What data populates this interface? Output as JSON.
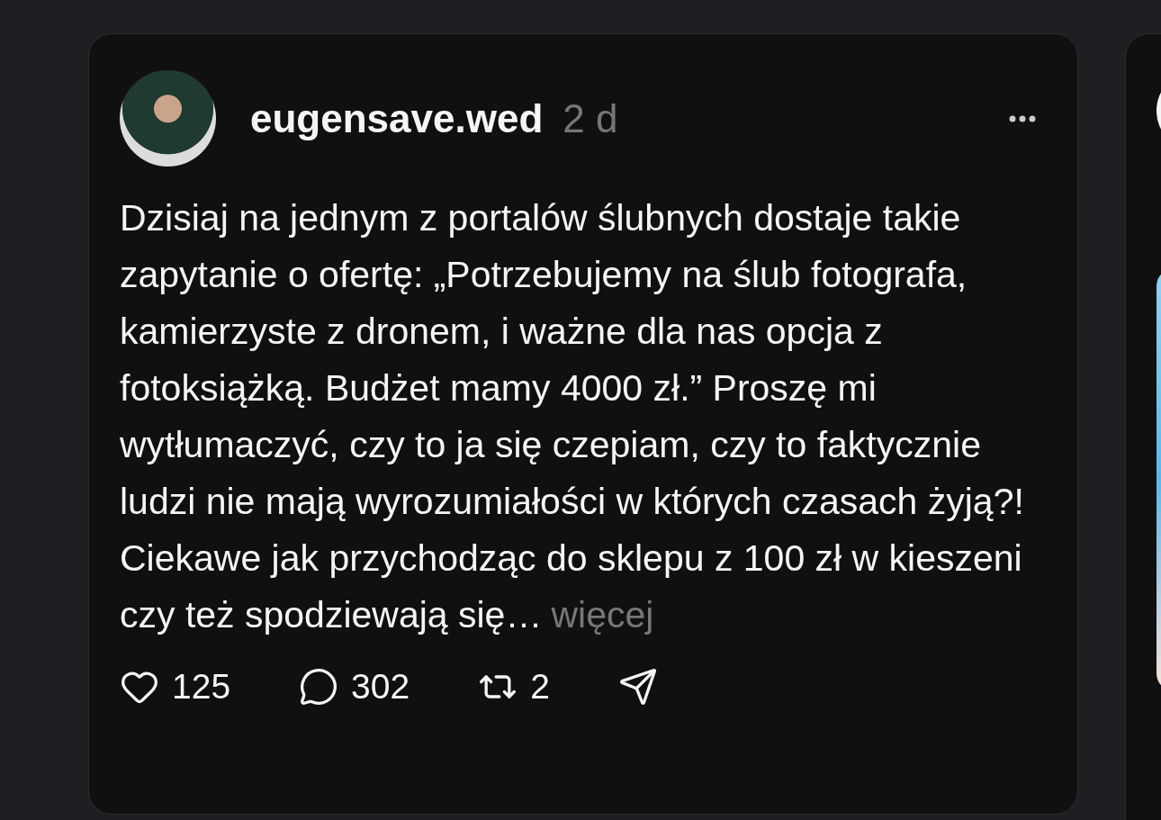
{
  "post": {
    "author": "eugensave.wed",
    "time": "2 d",
    "body": "Dzisiaj na jednym z portalów ślubnych dostaje takie zapytanie o ofertę: „Potrzebujemy na ślub fotografa, kamierzyste z dronem, i ważne dla nas opcja z fotoksiążką. Budżet mamy 4000 zł.” Proszę mi wytłumaczyć, czy to ja się czepiam, czy to faktycznie ludzi nie mają wyrozumiałości w których czasach żyją?! Ciekawe jak przychodząc do sklepu z 100 zł w kieszeni czy też spodziewają się…",
    "more": "więcej",
    "actions": [
      {
        "kind": "like",
        "count": "125"
      },
      {
        "kind": "comment",
        "count": "302"
      },
      {
        "kind": "repost",
        "count": "2"
      },
      {
        "kind": "share"
      }
    ]
  }
}
